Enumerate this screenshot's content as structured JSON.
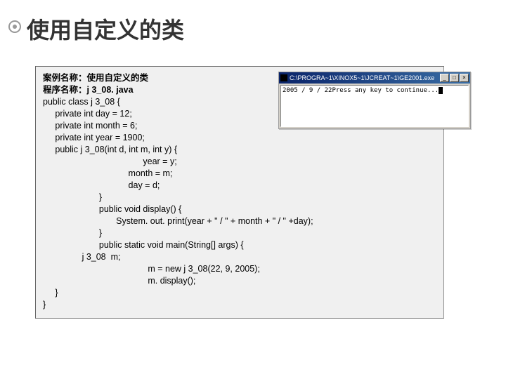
{
  "title": "使用自定义的类",
  "meta": {
    "caseLabel": "案例名称：",
    "caseName": "使用自定义的类",
    "progLabel": "程序名称：",
    "progName": "j 3_08. java"
  },
  "code": {
    "l1": "public class j 3_08 {",
    "l2": "     private int day = 12;",
    "l3": "     private int month = 6;",
    "l4": "     private int year = 1900;",
    "l5": "     public j 3_08(int d, int m, int y) {",
    "l6": "                                         year = y;",
    "l7": "                                   month = m;",
    "l8": "                                   day = d;",
    "l9": "                       }",
    "l10": "                       public void display() {",
    "l11": "                              System. out. print(year + \" / \" + month + \" / \" +day);",
    "l12": "                       }",
    "l13": "                       public static void main(String[] args) {",
    "l14": "                j 3_08  m;",
    "l15": "                                           m = new j 3_08(22, 9, 2005);",
    "l16": "                                           m. display();",
    "l17": "     }",
    "l18": "}"
  },
  "console": {
    "title": "C:\\PROGRA~1\\XINOX5~1\\JCREAT~1\\GE2001.exe",
    "output": "2005 / 9 / 22Press any key to continue..."
  },
  "buttons": {
    "min": "_",
    "max": "□",
    "close": "×"
  }
}
